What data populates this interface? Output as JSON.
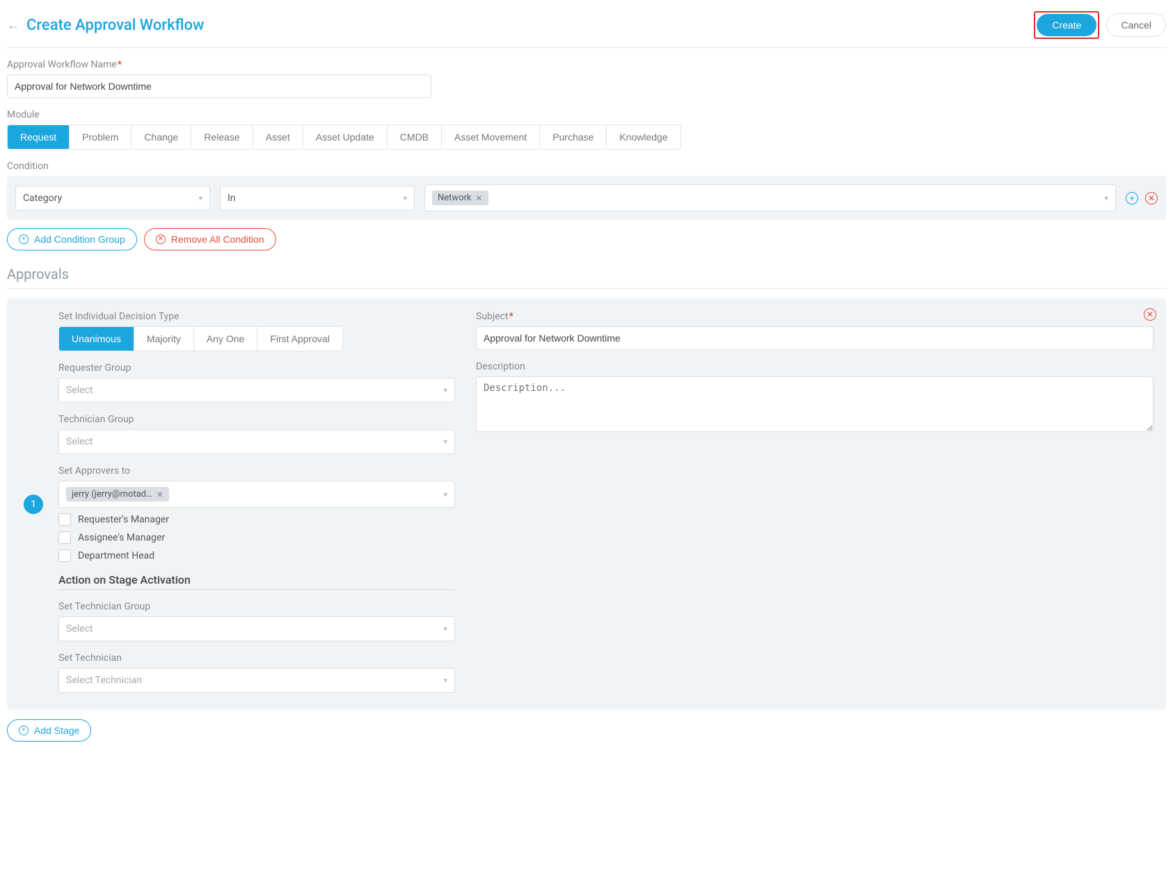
{
  "header": {
    "title": "Create Approval Workflow",
    "create_btn": "Create",
    "cancel_btn": "Cancel"
  },
  "workflow_name": {
    "label": "Approval Workflow Name",
    "value": "Approval for Network Downtime"
  },
  "module": {
    "label": "Module",
    "tabs": [
      "Request",
      "Problem",
      "Change",
      "Release",
      "Asset",
      "Asset Update",
      "CMDB",
      "Asset Movement",
      "Purchase",
      "Knowledge"
    ],
    "active": "Request"
  },
  "condition": {
    "label": "Condition",
    "field": "Category",
    "operator": "In",
    "value_chip": "Network",
    "add_group": "Add Condition Group",
    "remove_all": "Remove All Condition"
  },
  "approvals": {
    "heading": "Approvals",
    "stage_number": "1",
    "decision": {
      "label": "Set Individual Decision Type",
      "options": [
        "Unanimous",
        "Majority",
        "Any One",
        "First Approval"
      ],
      "active": "Unanimous"
    },
    "requester_group": {
      "label": "Requester Group",
      "placeholder": "Select"
    },
    "technician_group": {
      "label": "Technician Group",
      "placeholder": "Select"
    },
    "approvers": {
      "label": "Set Approvers to",
      "chip": "jerry (jerry@motad…",
      "cb1": "Requester's Manager",
      "cb2": "Assignee's Manager",
      "cb3": "Department Head"
    },
    "actions": {
      "heading": "Action on Stage Activation",
      "tech_group": {
        "label": "Set Technician Group",
        "placeholder": "Select"
      },
      "tech": {
        "label": "Set Technician",
        "placeholder": "Select Technician"
      }
    },
    "subject": {
      "label": "Subject",
      "value": "Approval for Network Downtime"
    },
    "description": {
      "label": "Description",
      "placeholder": "Description..."
    },
    "add_stage": "Add Stage"
  }
}
